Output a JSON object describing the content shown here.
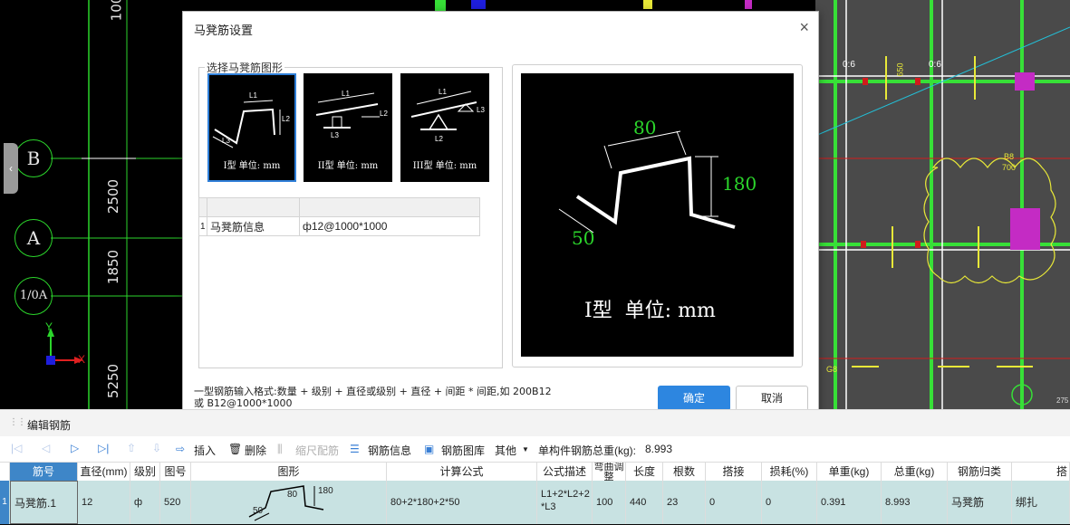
{
  "cad": {
    "axes": [
      {
        "label": "B"
      },
      {
        "label": "A"
      },
      {
        "label": "1/0A"
      }
    ],
    "dimensions": [
      "100",
      "2500",
      "1850",
      "5250"
    ],
    "ucs": {
      "x": "X",
      "y": "Y"
    },
    "side_tab": "‹",
    "right_labels": {
      "top_a": "0:6",
      "top_b": "0:6",
      "v650": "650",
      "b8": "B8",
      "v700": "700",
      "g8": "G8",
      "corner": "275"
    }
  },
  "dialog": {
    "title": "马凳筋设置",
    "close": "×",
    "group_label": "选择马凳筋图形",
    "thumbs": [
      {
        "caption": "I型 单位: mm",
        "l1": "L1",
        "l2": "L2",
        "l3": "L3"
      },
      {
        "caption": "II型 单位: mm",
        "l1": "L1",
        "l2": "L2",
        "l3": "L3"
      },
      {
        "caption": "III型 单位: mm",
        "l1": "L1",
        "l2": "L2",
        "l3": "L3"
      }
    ],
    "grid": {
      "row_no": "1",
      "name": "马凳筋信息",
      "value": "ф12@1000*1000"
    },
    "preview": {
      "l1": "80",
      "l2": "180",
      "l3": "50",
      "caption": "I型  单位: mm"
    },
    "hint_line1": "一型钢筋输入格式:数量 + 级别 + 直径或级别 + 直径 + 间距 * 间距,如 200B12",
    "hint_line2": "或 B12@1000*1000",
    "ok": "确定",
    "cancel": "取消"
  },
  "panel": {
    "title": "编辑钢筋",
    "toolbar": {
      "insert": "插入",
      "delete": "删除",
      "scale_rebar": "缩尺配筋",
      "rebar_info": "钢筋信息",
      "rebar_lib": "钢筋图库",
      "other": "其他",
      "total_label": "单构件钢筋总重(kg):",
      "total_value": "8.993"
    },
    "columns": [
      "筋号",
      "直径(mm)",
      "级别",
      "图号",
      "图形",
      "计算公式",
      "公式描述",
      "弯曲调整",
      "长度",
      "根数",
      "搭接",
      "损耗(%)",
      "单重(kg)",
      "总重(kg)",
      "钢筋归类",
      "搭"
    ],
    "row": {
      "num": "1",
      "name": "马凳筋.1",
      "diameter": "12",
      "grade": "ф",
      "fig_no": "520",
      "shape_l1": "80",
      "shape_l2": "180",
      "shape_l3": "50",
      "formula": "80+2*180+2*50",
      "formula_desc_1": "L1+2*L2+2",
      "formula_desc_2": "*L3",
      "bend": "100",
      "length": "440",
      "count": "23",
      "lap": "0",
      "loss": "0",
      "unit_weight": "0.391",
      "total_weight": "8.993",
      "category": "马凳筋",
      "lap_type": "绑扎"
    }
  }
}
